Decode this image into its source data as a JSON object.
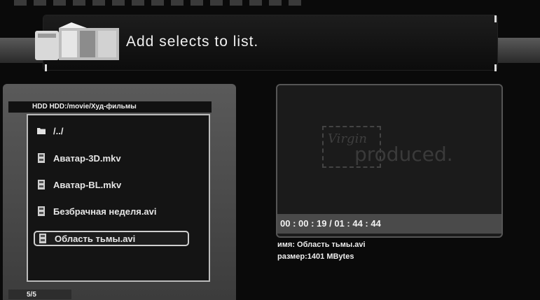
{
  "header": {
    "title": "Add selects to list.",
    "icon": "film-clapper-icon"
  },
  "browser": {
    "path": "HDD HDD:/movie/Худ-фильмы",
    "items": [
      {
        "label": "/../",
        "icon": "folder-icon"
      },
      {
        "label": "Аватар-3D.mkv",
        "icon": "video-file-icon"
      },
      {
        "label": "Аватар-BL.mkv",
        "icon": "video-file-icon"
      },
      {
        "label": "Безбрачная неделя.avi",
        "icon": "video-file-icon"
      },
      {
        "label": "Область тьмы.avi",
        "icon": "video-file-icon",
        "selected": true
      }
    ],
    "counter": "5/5"
  },
  "preview": {
    "logo_script": "Virgin",
    "logo_text": "produced.",
    "timecode": "00 : 00 : 19 / 01 : 44 : 44",
    "name_line": "имя: Область тьмы.avi",
    "size_line": "размер:1401 MBytes"
  },
  "colors": {
    "background": "#0a0a0a",
    "panel": "#4a4a4a",
    "selection_border": "#cfcfcf"
  }
}
